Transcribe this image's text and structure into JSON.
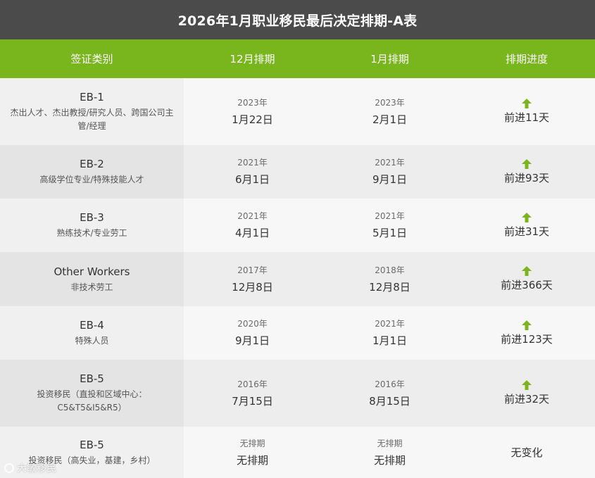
{
  "title": "2026年1月职业移民最后决定排期-A表",
  "headers": {
    "category": "签证类别",
    "dec": "12月排期",
    "jan": "1月排期",
    "progress": "排期进度"
  },
  "colors": {
    "title_bg": "#4b4b4b",
    "header_bg": "#79b51c",
    "arrow": "#7ab51d"
  },
  "rows": [
    {
      "name": "EB-1",
      "desc": "杰出人才、杰出教授/研究人员、跨国公司主管/经理",
      "dec_year": "2023年",
      "dec_day": "1月22日",
      "jan_year": "2023年",
      "jan_day": "2月1日",
      "arrow": "arrow-up-icon",
      "progress": "前进11天"
    },
    {
      "name": "EB-2",
      "desc": "高级学位专业/特殊技能人才",
      "dec_year": "2021年",
      "dec_day": "6月1日",
      "jan_year": "2021年",
      "jan_day": "9月1日",
      "arrow": "arrow-up-icon",
      "progress": "前进93天"
    },
    {
      "name": "EB-3",
      "desc": "熟练技术/专业劳工",
      "dec_year": "2021年",
      "dec_day": "4月1日",
      "jan_year": "2021年",
      "jan_day": "5月1日",
      "arrow": "arrow-up-icon",
      "progress": "前进31天"
    },
    {
      "name": "Other Workers",
      "desc": "非技术劳工",
      "dec_year": "2017年",
      "dec_day": "12月8日",
      "jan_year": "2018年",
      "jan_day": "12月8日",
      "arrow": "arrow-up-icon",
      "progress": "前进366天"
    },
    {
      "name": "EB-4",
      "desc": "特殊人员",
      "dec_year": "2020年",
      "dec_day": "9月1日",
      "jan_year": "2021年",
      "jan_day": "1月1日",
      "arrow": "arrow-up-icon",
      "progress": "前进123天"
    },
    {
      "name": "EB-5",
      "desc": "投资移民（直投和区域中心：C5&T5&I5&R5）",
      "dec_year": "2016年",
      "dec_day": "7月15日",
      "jan_year": "2016年",
      "jan_day": "8月15日",
      "arrow": "arrow-up-icon",
      "progress": "前进32天"
    },
    {
      "name": "EB-5",
      "desc": "投资移民（高失业，基建，乡村）",
      "dec_year": "无排期",
      "dec_day": "无排期",
      "jan_year": "无排期",
      "jan_day": "无排期",
      "arrow": "",
      "progress": "无变化"
    }
  ],
  "watermark": "大敏移民"
}
